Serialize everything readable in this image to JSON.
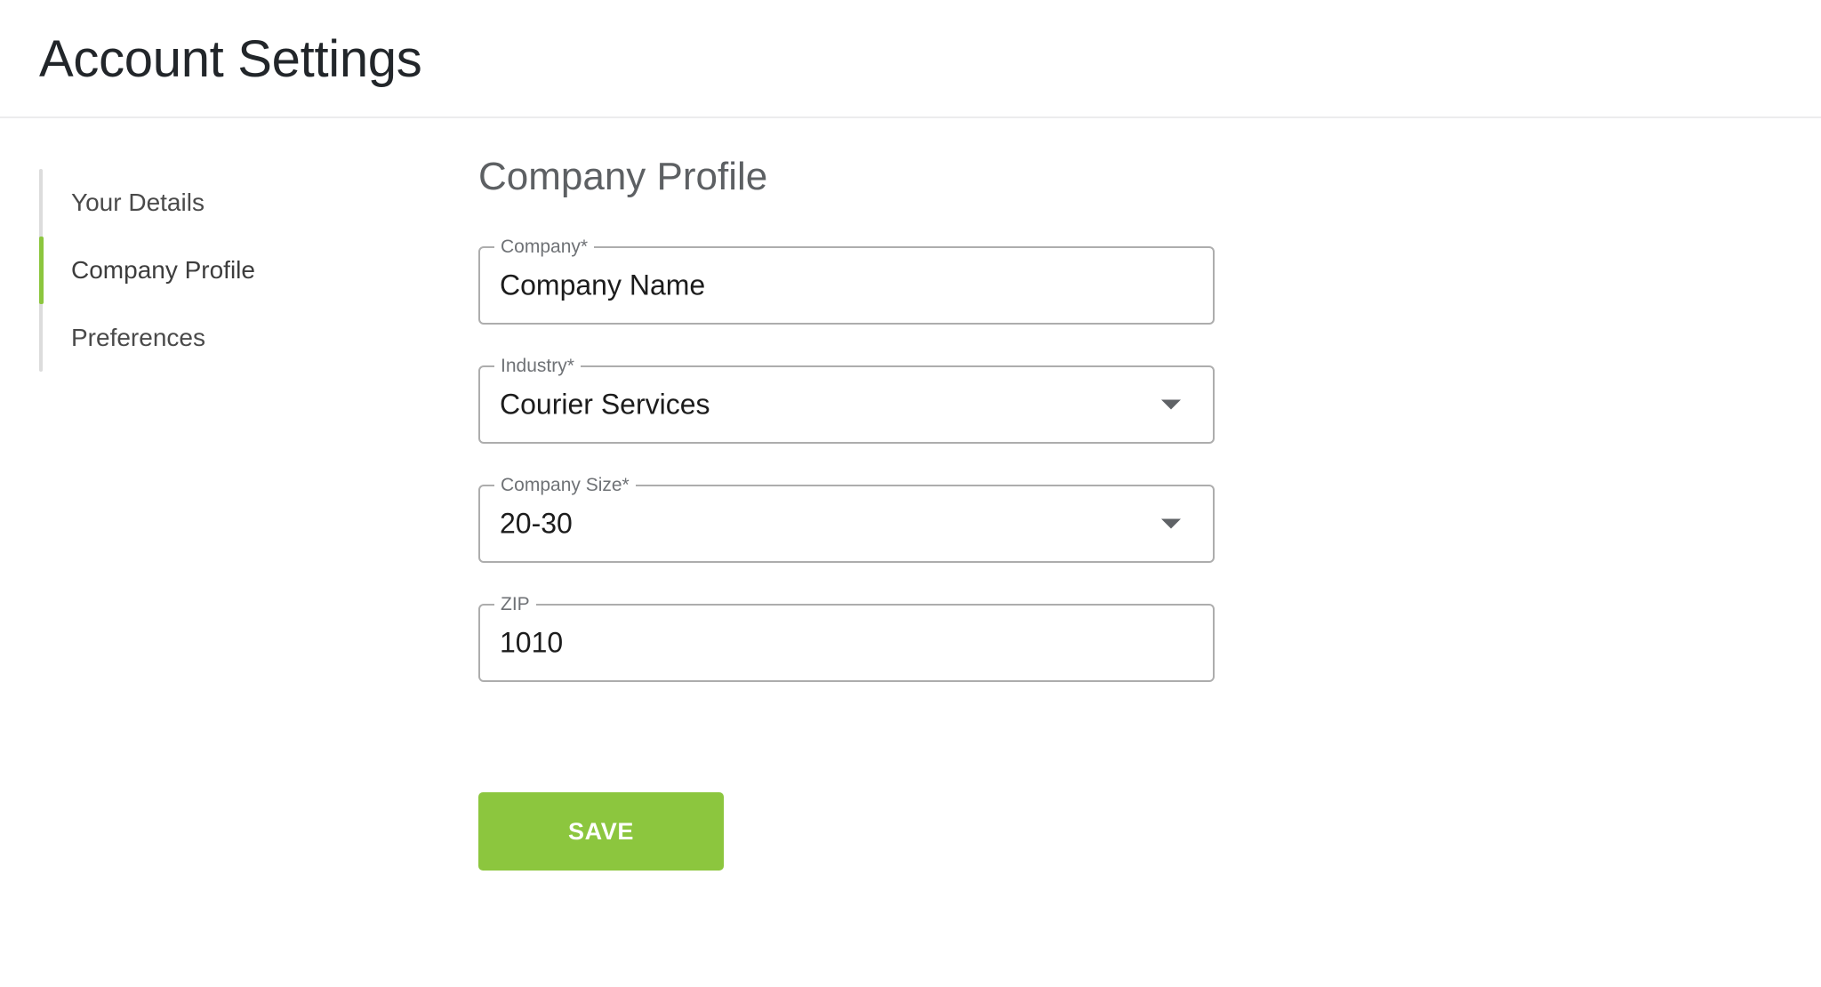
{
  "header": {
    "title": "Account Settings"
  },
  "sidebar": {
    "items": [
      {
        "label": "Your Details",
        "active": false
      },
      {
        "label": "Company Profile",
        "active": true
      },
      {
        "label": "Preferences",
        "active": false
      }
    ]
  },
  "main": {
    "section_title": "Company Profile",
    "fields": [
      {
        "label": "Company*",
        "value": "Company Name",
        "placeholder": "Company",
        "type": "text"
      },
      {
        "label": "Industry*",
        "value": "Courier Services",
        "placeholder": "Industry",
        "type": "select"
      },
      {
        "label": "Company Size*",
        "value": "20-30",
        "placeholder": "Company Size",
        "type": "select"
      },
      {
        "label": "ZIP",
        "value": "1010",
        "placeholder": "ZIP",
        "type": "text"
      }
    ],
    "save_label": "SAVE"
  },
  "colors": {
    "accent_green": "#8cc63e",
    "rail_gray": "#dcdcdc",
    "field_border": "#adadad",
    "label_gray": "#6f7276",
    "value_dark": "#1c1c1c",
    "title_dark": "#22262a",
    "section_gray": "#5d6063",
    "divider": "#ececed"
  }
}
